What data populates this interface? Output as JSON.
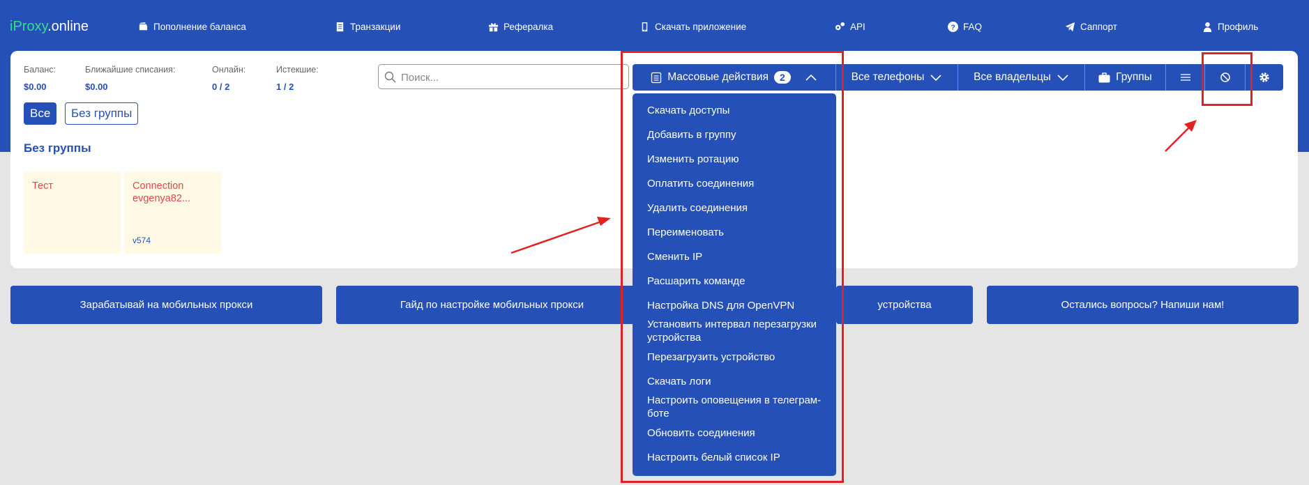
{
  "header": {
    "logo_main": "iProxy",
    "logo_suffix": ".online",
    "nav": [
      {
        "label": "Пополнение баланса",
        "icon": "wallet-icon"
      },
      {
        "label": "Транзакции",
        "icon": "document-icon"
      },
      {
        "label": "Рефералка",
        "icon": "gift-icon"
      },
      {
        "label": "Скачать приложение",
        "icon": "phone-icon"
      },
      {
        "label": "API",
        "icon": "gears-icon"
      },
      {
        "label": "FAQ",
        "icon": "question-icon"
      },
      {
        "label": "Саппорт",
        "icon": "telegram-icon"
      },
      {
        "label": "Профиль",
        "icon": "user-icon"
      }
    ]
  },
  "stats": [
    {
      "label": "Баланс:",
      "value": "$0.00"
    },
    {
      "label": "Ближайшие списания:",
      "value": "$0.00"
    },
    {
      "label": "Онлайн:",
      "value": "0 / 2"
    },
    {
      "label": "Истекшие:",
      "value": "1 / 2"
    }
  ],
  "filters": [
    {
      "label": "Все",
      "active": true
    },
    {
      "label": "Без группы",
      "active": false
    }
  ],
  "search": {
    "placeholder": "Поиск..."
  },
  "toolbar": {
    "bulk_label": "Массовые действия",
    "bulk_count": "2",
    "phones_label": "Все телефоны",
    "owners_label": "Все владельцы",
    "groups_label": "Группы"
  },
  "group": {
    "title": "Без группы",
    "cards": [
      {
        "name": "Тест",
        "line2": "",
        "footer": ""
      },
      {
        "name": "Connection",
        "line2": "evgenya82...",
        "footer": "v574"
      }
    ]
  },
  "dropdown": {
    "items": [
      "Скачать доступы",
      "Добавить в группу",
      "Изменить ротацию",
      "Оплатить соединения",
      "Удалить соединения",
      "Переименовать",
      "Сменить IP",
      "Расшарить команде",
      "Настройка DNS для OpenVPN",
      "Установить интервал перезагрузки устройства",
      "Перезагрузить устройство",
      "Скачать логи",
      "Настроить оповещения в телеграм-боте",
      "Обновить соединения",
      "Настроить белый список IP"
    ]
  },
  "banners": [
    "Зарабатывай на мобильных прокси",
    "Гайд по настройке мобильных прокси",
    "устройства",
    "Остались вопросы? Напиши нам!"
  ],
  "colors": {
    "brand": "#2550b8",
    "accent_green": "#2ee08a",
    "annotation_red": "#e22222"
  }
}
